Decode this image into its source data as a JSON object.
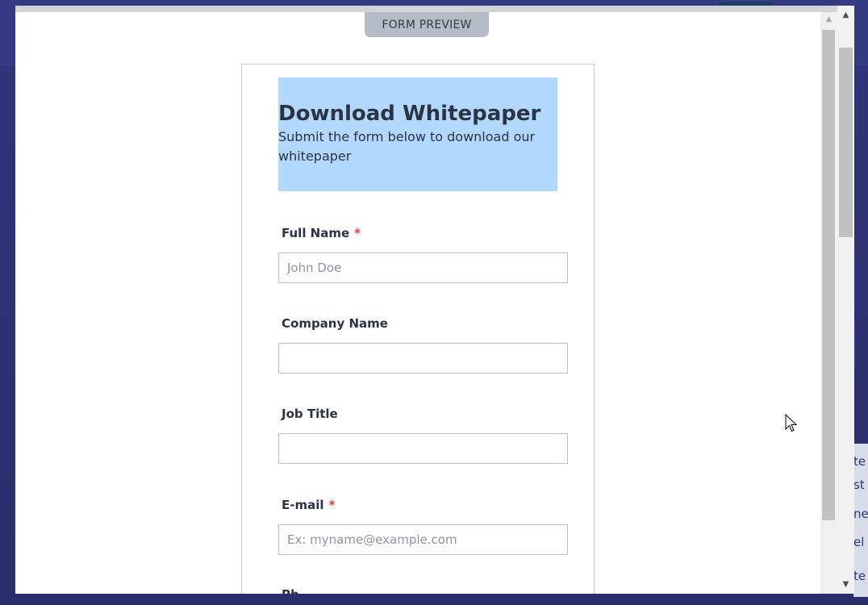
{
  "modal": {
    "tab_label": "FORM PREVIEW"
  },
  "form": {
    "title": "Download Whitepaper",
    "subtitle": "Submit the form below to download our whitepaper",
    "header_color": "#b2d8fd",
    "fields": [
      {
        "label": "Full Name",
        "required": true,
        "placeholder": "John Doe",
        "value": ""
      },
      {
        "label": "Company Name",
        "required": false,
        "placeholder": "",
        "value": ""
      },
      {
        "label": "Job Title",
        "required": false,
        "placeholder": "",
        "value": ""
      },
      {
        "label": "E-mail",
        "required": true,
        "placeholder": "Ex: myname@example.com",
        "value": ""
      }
    ],
    "partial_next_label": "Ph"
  },
  "icons": {
    "scroll_up": "chevron-up-icon",
    "scroll_down": "chevron-down-icon",
    "cursor": "mouse-pointer-icon"
  },
  "background_text": [
    "te",
    "st",
    "ne",
    "el",
    "te"
  ]
}
